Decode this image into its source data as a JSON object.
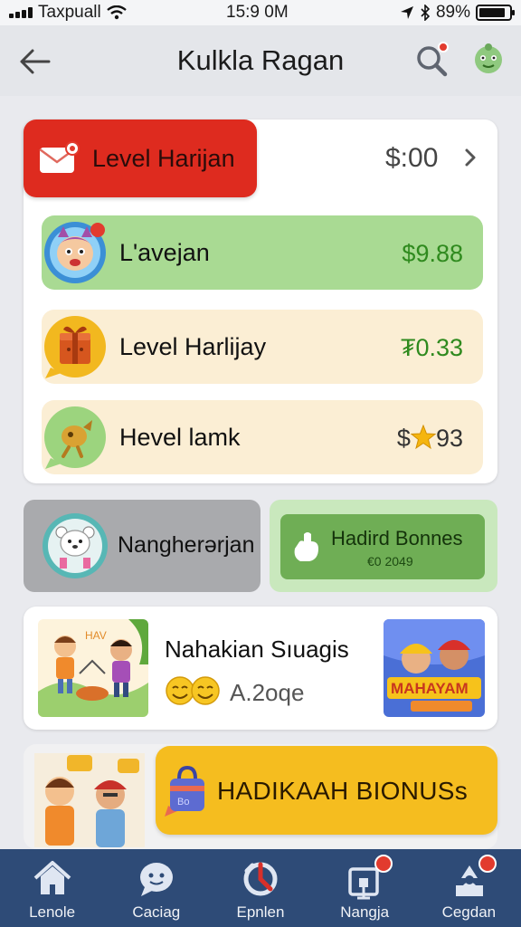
{
  "status_bar": {
    "carrier": "Taxpuall",
    "time": "15:9 0M",
    "battery": "89%"
  },
  "header": {
    "title": "Kulkla Ragan"
  },
  "featured_card": {
    "tag_label": "Level Harijan",
    "amount": "$:00",
    "rows": [
      {
        "label": "L'avejan",
        "amount": "$9.88",
        "icon": "cartoon-avatar-icon"
      },
      {
        "label": "Level Harlijay",
        "amount": "₮0.33",
        "icon": "gift-box-icon"
      },
      {
        "label": "Hevel lamk",
        "amount_prefix": "$",
        "amount_suffix": "93",
        "icon": "coin-character-icon"
      }
    ]
  },
  "tiles": {
    "left_label": "Nangherərjan",
    "bonus_title": "Hadird Bonnes",
    "bonus_sub": "€0 2049"
  },
  "promo": {
    "title": "Nahakian Sıuagis",
    "value": "A.2oqe"
  },
  "banner": {
    "label": "HADIKAAH BIONUSs"
  },
  "nav": [
    {
      "label": "Lenole",
      "icon": "home-icon"
    },
    {
      "label": "Caciag",
      "icon": "chat-icon"
    },
    {
      "label": "Epnlen",
      "icon": "refresh-icon"
    },
    {
      "label": "Nangja",
      "icon": "gift-icon"
    },
    {
      "label": "Cegdan",
      "icon": "user-icon"
    }
  ],
  "colors": {
    "header_tag": "#de2b1f",
    "row_green": "#a9da93",
    "row_cream": "#fbeed4",
    "nav_bg": "#2e4b77",
    "banner": "#f5bd1f"
  }
}
